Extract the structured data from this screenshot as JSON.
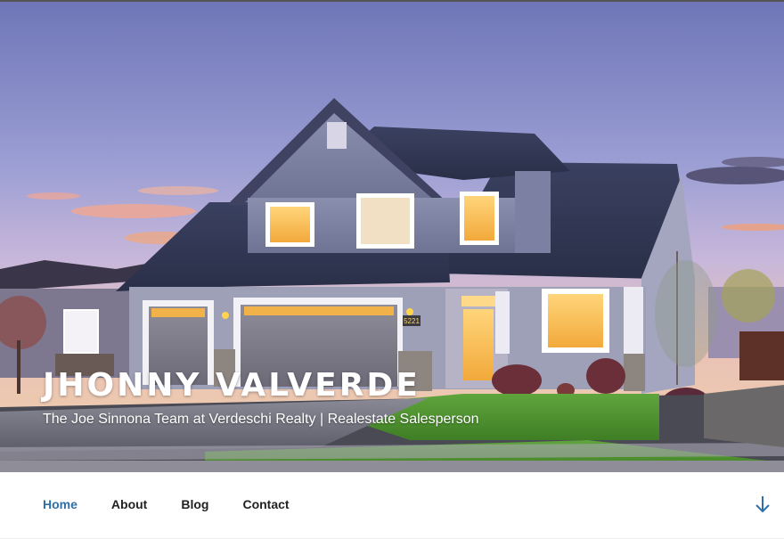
{
  "site": {
    "title": "JHONNY VALVERDE",
    "tagline": "The Joe Sinnona Team at Verdeschi Realty | Realestate Salesperson",
    "house_number": "5221"
  },
  "nav": {
    "items": [
      {
        "label": "Home",
        "active": true
      },
      {
        "label": "About",
        "active": false
      },
      {
        "label": "Blog",
        "active": false
      },
      {
        "label": "Contact",
        "active": false
      }
    ],
    "scroll_icon": "arrow-down-icon"
  },
  "colors": {
    "accent": "#2e6fa7",
    "nav_text": "#222222",
    "title_text": "#ffffff"
  }
}
